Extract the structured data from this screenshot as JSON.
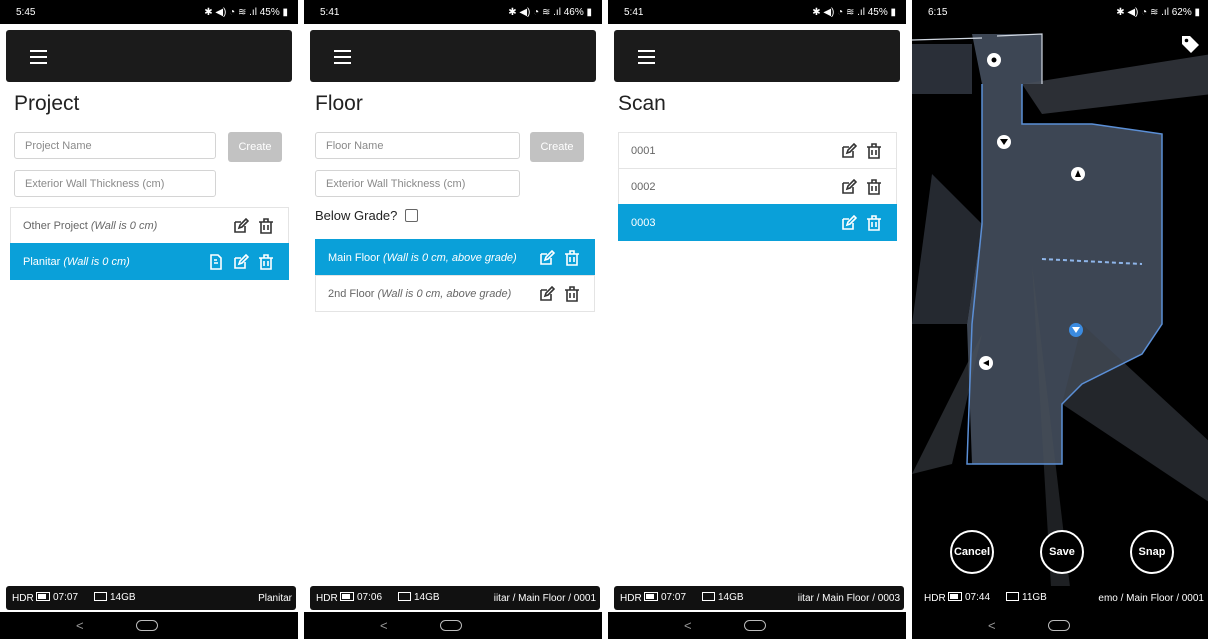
{
  "screens": [
    {
      "status_time": "5:45",
      "status_right": "✱ ◀) ◔ ≋ .ıl 45% ▮",
      "title": "Project",
      "name_placeholder": "Project Name",
      "create_label": "Create",
      "wall_placeholder": "Exterior Wall Thickness (cm)",
      "items": [
        {
          "name": "Other Project",
          "note": "(Wall is 0 cm)"
        },
        {
          "name": "Planitar",
          "note": "(Wall is 0 cm)"
        }
      ],
      "camera": {
        "hdr": "HDR",
        "battery_time": "07:07",
        "storage": "14GB",
        "path": "Planitar"
      }
    },
    {
      "status_time": "5:41",
      "status_right": "✱ ◀) ◔ ≋ .ıl 46% ▮",
      "title": "Floor",
      "name_placeholder": "Floor Name",
      "create_label": "Create",
      "wall_placeholder": "Exterior Wall Thickness (cm)",
      "below_grade_label": "Below Grade?",
      "items": [
        {
          "name": "Main Floor",
          "note": "(Wall is 0 cm, above grade)"
        },
        {
          "name": "2nd Floor",
          "note": "(Wall is 0 cm, above grade)"
        }
      ],
      "camera": {
        "hdr": "HDR",
        "battery_time": "07:06",
        "storage": "14GB",
        "path": "iitar / Main Floor / 0001"
      }
    },
    {
      "status_time": "5:41",
      "status_right": "✱ ◀) ◔ ≋ .ıl 45% ▮",
      "title": "Scan",
      "items": [
        {
          "name": "0001"
        },
        {
          "name": "0002"
        },
        {
          "name": "0003"
        }
      ],
      "camera": {
        "hdr": "HDR",
        "battery_time": "07:07",
        "storage": "14GB",
        "path": "iitar / Main Floor / 0003"
      }
    },
    {
      "status_time": "6:15",
      "status_right": "✱ ◀) ◔ ≋ .ıl 62% ▮",
      "buttons": {
        "cancel": "Cancel",
        "save": "Save",
        "snap": "Snap"
      },
      "camera": {
        "hdr": "HDR",
        "battery_time": "07:44",
        "storage": "11GB",
        "path": "emo / Main Floor / 0001"
      }
    }
  ],
  "colors": {
    "accent": "#0aa0d9",
    "appbar": "#1b1b1b",
    "create_disabled": "#c2c2c2"
  },
  "icons": {
    "edit": "edit-icon",
    "delete": "delete-icon",
    "document": "document-icon",
    "tag": "tag-icon",
    "menu": "menu-icon"
  }
}
